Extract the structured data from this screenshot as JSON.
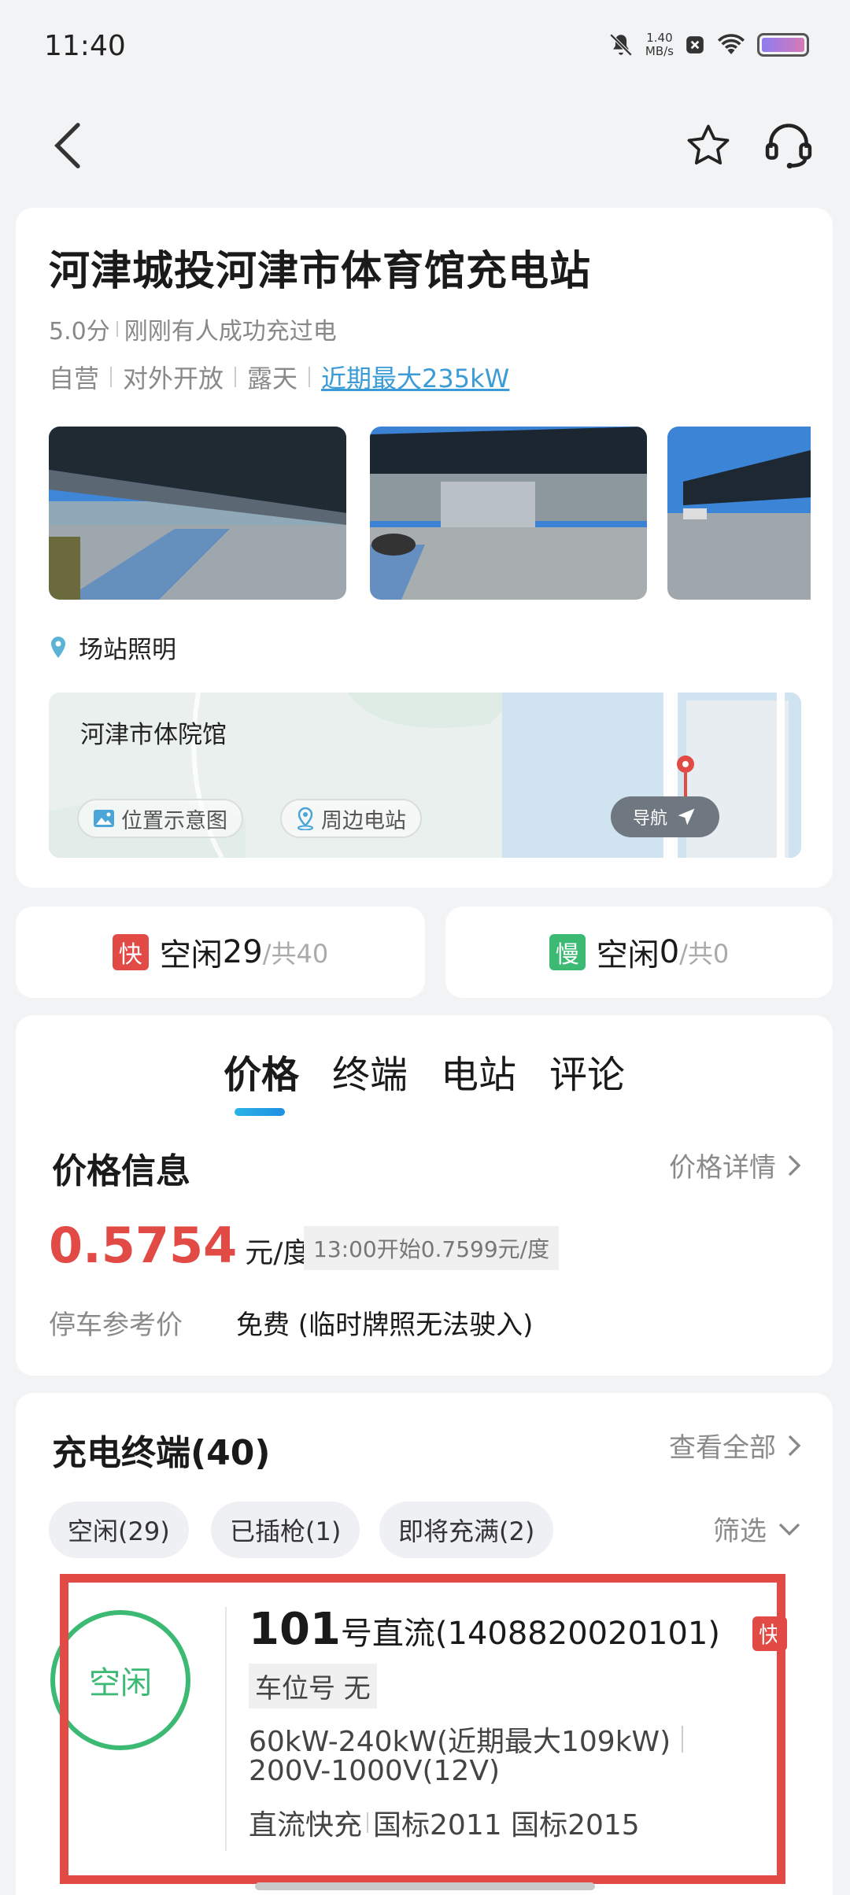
{
  "status_bar": {
    "time": "11:40",
    "net_speed_value": "1.40",
    "net_speed_unit": "MB/s",
    "icons": [
      "mute-bell-icon",
      "close-box-icon",
      "wifi-icon",
      "battery-icon"
    ]
  },
  "header": {
    "back_icon": "chevron-left-icon",
    "favorite_icon": "star-outline-icon",
    "support_icon": "headset-icon"
  },
  "station": {
    "name": "河津城投河津市体育馆充电站",
    "rating": "5.0分",
    "recent_activity": "刚刚有人成功充过电",
    "tags": [
      "自营",
      "对外开放",
      "露天"
    ],
    "max_power_link": "近期最大235kW",
    "amenity": "场站照明",
    "map": {
      "place_name": "河津市体院馆",
      "location_chip": "位置示意图",
      "nearby_chip": "周边电站",
      "nav_label": "导航"
    }
  },
  "availability": {
    "fast": {
      "tag": "快",
      "label": "空闲",
      "free": "29",
      "total": "/共40",
      "color": "#e24a45"
    },
    "slow": {
      "tag": "慢",
      "label": "空闲",
      "free": "0",
      "total": "/共0",
      "color": "#3cba74"
    }
  },
  "tabs": [
    "价格",
    "终端",
    "电站",
    "评论"
  ],
  "active_tab": "价格",
  "price_info": {
    "title": "价格信息",
    "detail_link": "价格详情",
    "current_price": "0.5754",
    "unit": "元/度",
    "next_price": "13:00开始0.7599元/度",
    "parking_label": "停车参考价",
    "parking_value": "免费 (临时牌照无法驶入)"
  },
  "terminals": {
    "title": "充电终端(40)",
    "view_all": "查看全部",
    "filters": [
      "空闲(29)",
      "已插枪(1)",
      "即将充满(2)"
    ],
    "filter_label": "筛选",
    "item": {
      "status": "空闲",
      "number": "101",
      "name_suffix": "号直流(1408820020101)",
      "spot": "车位号 无",
      "power": "60kW-240kW(近期最大109kW)",
      "voltage": "200V-1000V(12V)",
      "type": "直流快充",
      "standards": "国标2011 国标2015",
      "tag": "快"
    }
  }
}
